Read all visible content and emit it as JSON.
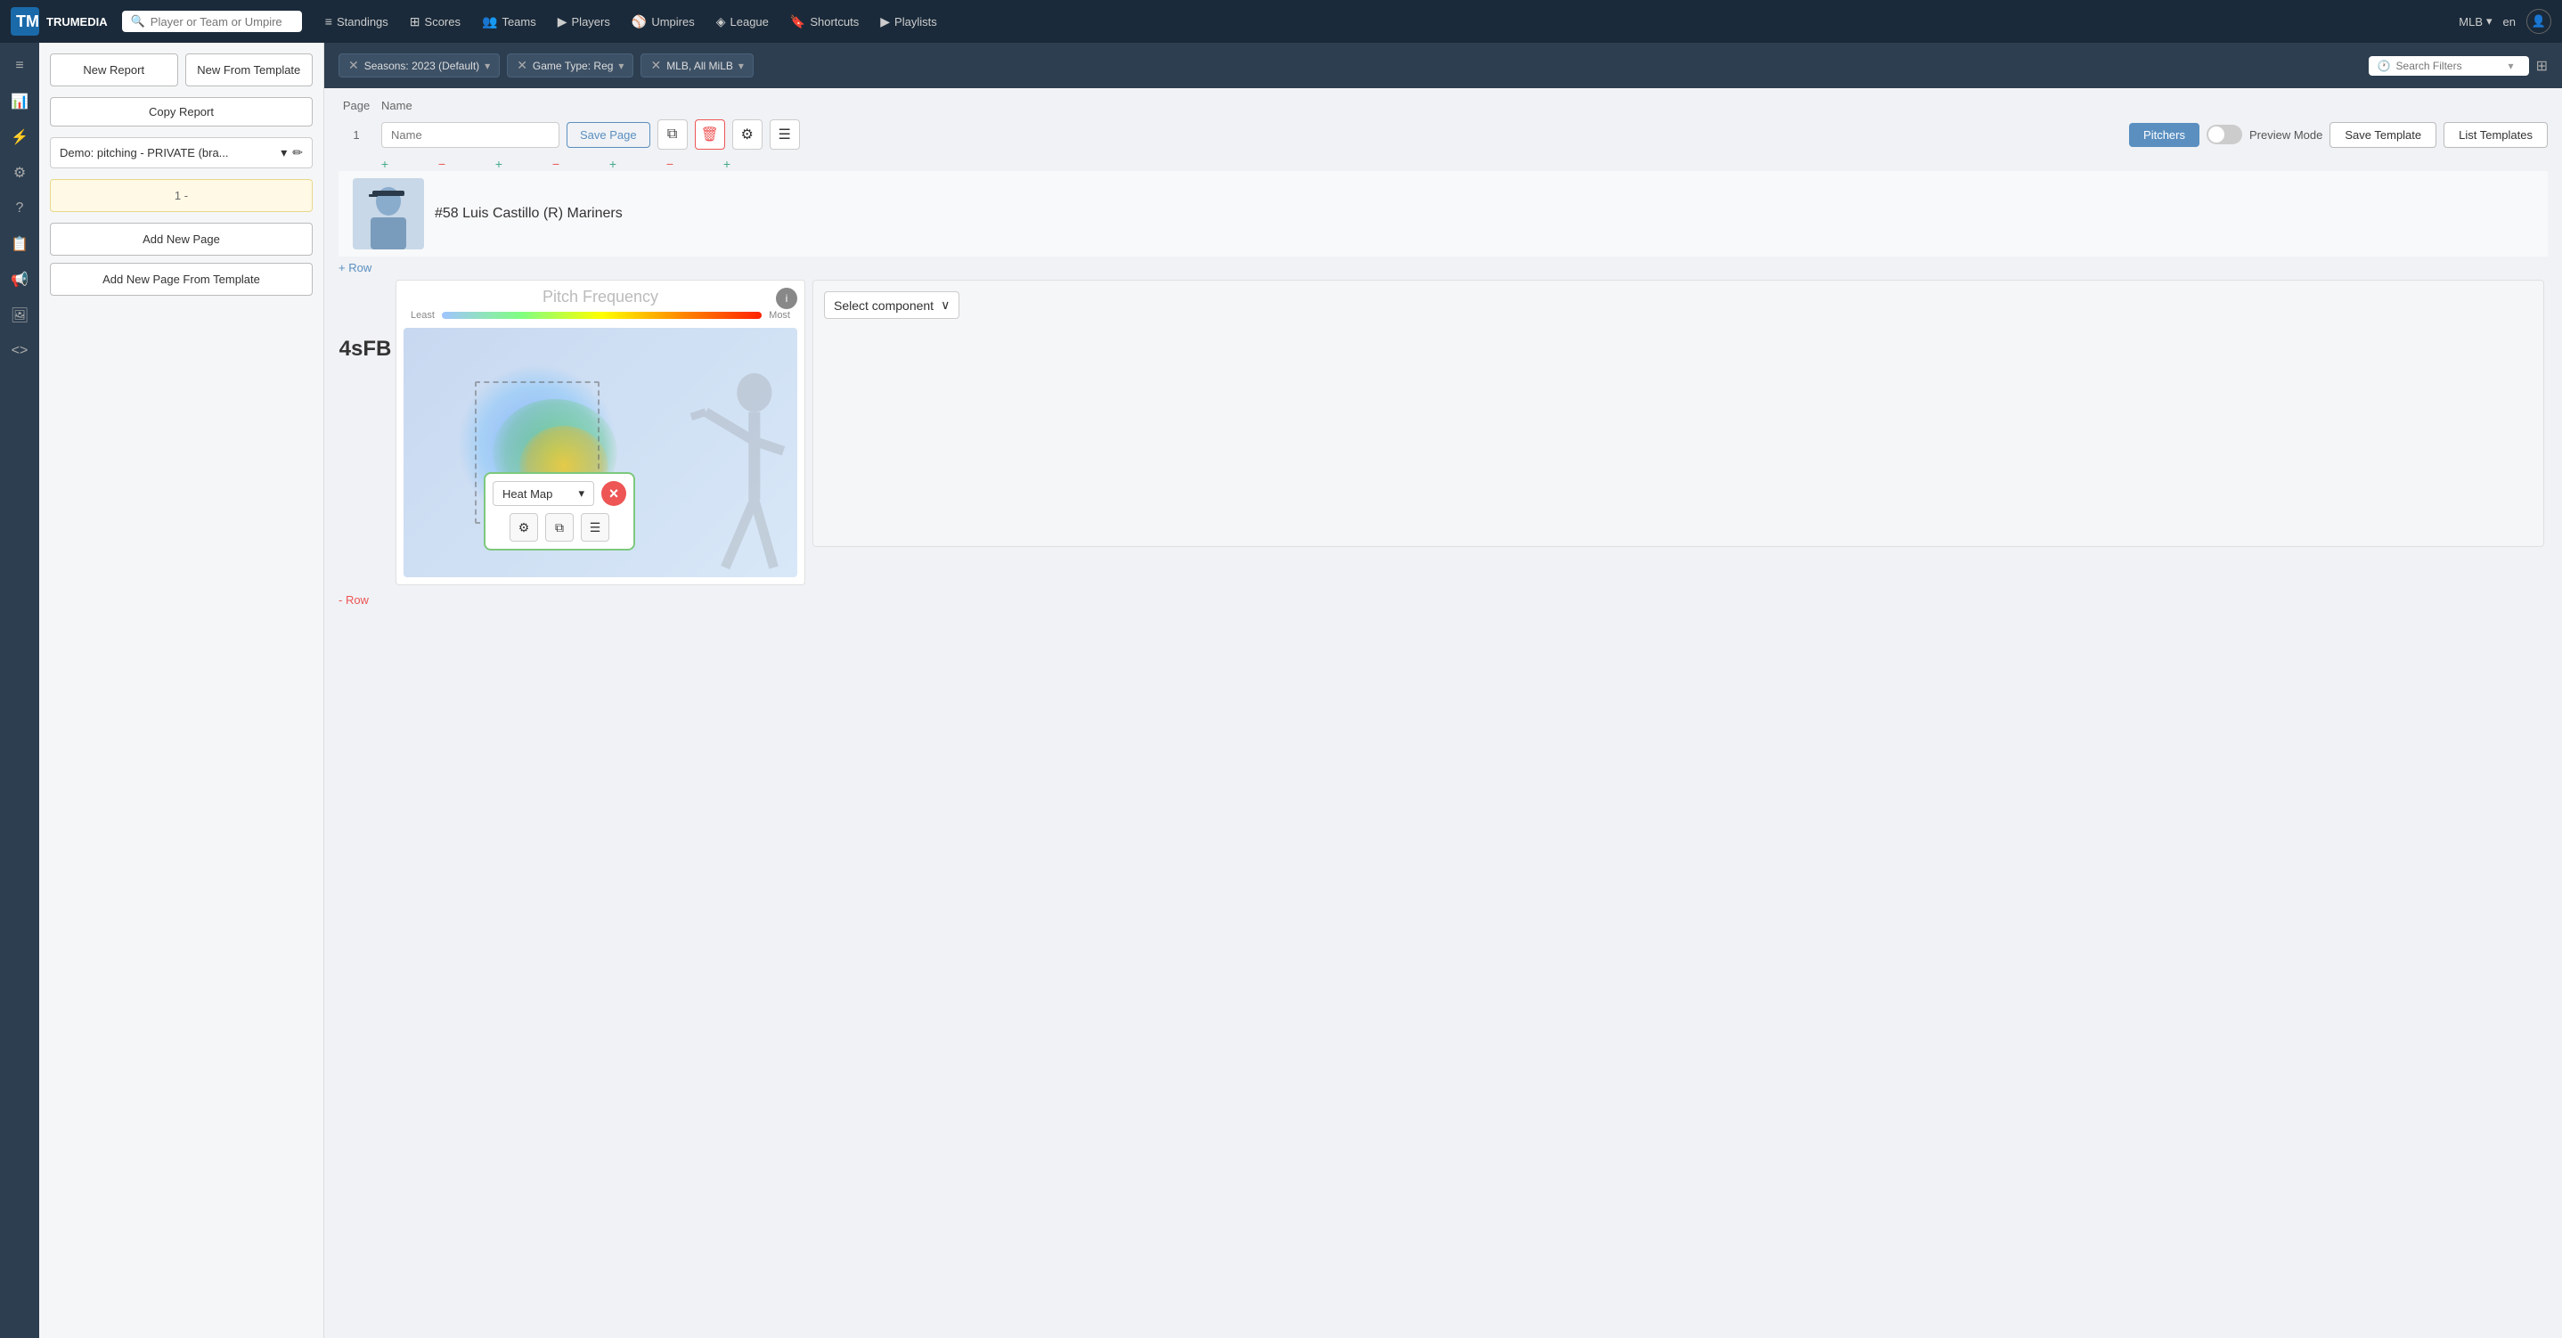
{
  "topNav": {
    "logoText": "TRUMEDIA",
    "searchPlaceholder": "Player or Team or Umpire",
    "navItems": [
      {
        "label": "Standings",
        "icon": "≡"
      },
      {
        "label": "Scores",
        "icon": "⊞"
      },
      {
        "label": "Teams",
        "icon": "👥"
      },
      {
        "label": "Players",
        "icon": "▶"
      },
      {
        "label": "Umpires",
        "icon": "🎯"
      },
      {
        "label": "League",
        "icon": "◈"
      },
      {
        "label": "Shortcuts",
        "icon": "🔖"
      },
      {
        "label": "Playlists",
        "icon": "▶"
      }
    ],
    "league": "MLB",
    "lang": "en"
  },
  "sidebar": {
    "icons": [
      "≡",
      "📊",
      "⚡",
      "⚙",
      "?",
      "📋",
      "📢",
      "🖼",
      "<>"
    ]
  },
  "panel": {
    "newReportLabel": "New Report",
    "newFromTemplateLabel": "New From Template",
    "copyReportLabel": "Copy Report",
    "demoLabel": "Demo: pitching - PRIVATE (bra...",
    "pageItem": "1 -",
    "addNewPageLabel": "Add New Page",
    "addNewPageFromTemplateLabel": "Add New Page From Template"
  },
  "filters": {
    "chips": [
      {
        "label": "Seasons: 2023 (Default)",
        "removable": true
      },
      {
        "label": "Game Type: Reg",
        "removable": true
      },
      {
        "label": "MLB, All MiLB",
        "removable": true
      }
    ],
    "searchPlaceholder": "Search Filters"
  },
  "pageEditor": {
    "pageNum": "1",
    "nameInputValue": "Name",
    "nameInputPlaceholder": "Name",
    "savePageLabel": "Save Page",
    "pitchersLabel": "Pitchers",
    "previewModeLabel": "Preview Mode",
    "saveTemplateLabel": "Save Template",
    "listTemplatesLabel": "List Templates",
    "addRowLabel": "+ Row",
    "removeRowLabel": "- Row"
  },
  "player": {
    "number": "58",
    "name": "Luis Castillo",
    "hand": "R",
    "team": "Mariners",
    "displayText": "#58 Luis Castillo (R) Mariners"
  },
  "heatmap": {
    "title": "Pitch Frequency",
    "legendLeast": "Least",
    "legendMost": "Most",
    "pitchLabel": "4sFB",
    "componentType": "Heat Map",
    "infoBtnLabel": "i"
  },
  "componentPopup": {
    "selectLabel": "Heat Map",
    "closeLabel": "×",
    "settingsIcon": "⚙",
    "copyIcon": "⧉",
    "filterIcon": "≡"
  },
  "emptyComponent": {
    "selectLabel": "Select component",
    "chevron": "∨"
  },
  "columnControls": {
    "items": [
      "+",
      "-",
      "+",
      "-",
      "+",
      "-",
      "+"
    ]
  }
}
